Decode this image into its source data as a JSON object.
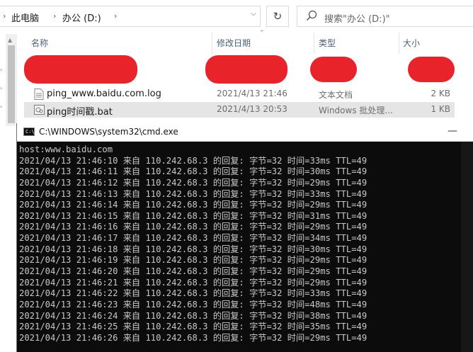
{
  "explorer": {
    "breadcrumb": [
      "此电脑",
      "办公 (D:)"
    ],
    "search_placeholder": "搜索\"办公 (D:)\"",
    "columns": {
      "name": "名称",
      "date": "修改日期",
      "type": "类型",
      "size": "大小"
    },
    "files": [
      {
        "name": "ping_www.baidu.com.log",
        "date": "2021/4/13 21:46",
        "type": "文本文档",
        "size": "2 KB",
        "icon": "text-file-icon",
        "selected": false
      },
      {
        "name": "ping时间戳.bat",
        "date": "2021/4/13 20:53",
        "type": "Windows 批处理...",
        "size": "1 KB",
        "icon": "batch-file-icon",
        "selected": true
      }
    ]
  },
  "cmd": {
    "title": "C:\\WINDOWS\\system32\\cmd.exe",
    "lines": [
      "host:www.baidu.com",
      "2021/04/13 21:46:10 来自 110.242.68.3 的回复: 字节=32 时间=33ms TTL=49",
      "2021/04/13 21:46:11 来自 110.242.68.3 的回复: 字节=32 时间=30ms TTL=49",
      "2021/04/13 21:46:12 来自 110.242.68.3 的回复: 字节=32 时间=29ms TTL=49",
      "2021/04/13 21:46:13 来自 110.242.68.3 的回复: 字节=32 时间=33ms TTL=49",
      "2021/04/13 21:46:14 来自 110.242.68.3 的回复: 字节=32 时间=29ms TTL=49",
      "2021/04/13 21:46:15 来自 110.242.68.3 的回复: 字节=32 时间=31ms TTL=49",
      "2021/04/13 21:46:16 来自 110.242.68.3 的回复: 字节=32 时间=29ms TTL=49",
      "2021/04/13 21:46:17 来自 110.242.68.3 的回复: 字节=32 时间=34ms TTL=49",
      "2021/04/13 21:46:18 来自 110.242.68.3 的回复: 字节=32 时间=30ms TTL=49",
      "2021/04/13 21:46:19 来自 110.242.68.3 的回复: 字节=32 时间=29ms TTL=49",
      "2021/04/13 21:46:20 来自 110.242.68.3 的回复: 字节=32 时间=29ms TTL=49",
      "2021/04/13 21:46:21 来自 110.242.68.3 的回复: 字节=32 时间=29ms TTL=49",
      "2021/04/13 21:46:22 来自 110.242.68.3 的回复: 字节=32 时间=33ms TTL=49",
      "2021/04/13 21:46:23 来自 110.242.68.3 的回复: 字节=32 时间=48ms TTL=49",
      "2021/04/13 21:46:24 来自 110.242.68.3 的回复: 字节=32 时间=38ms TTL=49",
      "2021/04/13 21:46:25 来自 110.242.68.3 的回复: 字节=32 时间=35ms TTL=49",
      "2021/04/13 21:46:26 来自 110.242.68.3 的回复: 字节=32 时间=29ms TTL=49"
    ]
  },
  "colors": {
    "redaction": "#e8232a",
    "console_bg": "#0c0c0c",
    "console_text": "#c8c8c8"
  }
}
